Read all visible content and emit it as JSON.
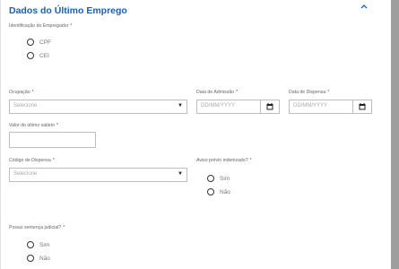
{
  "section": {
    "title": "Dados do Último Emprego"
  },
  "employer_id": {
    "label": "Identificação do Empregador",
    "required_mark": "*",
    "options": [
      "CPF",
      "CEI"
    ]
  },
  "occupation": {
    "label": "Ocupação",
    "required_mark": "*",
    "placeholder": "Selecione",
    "caret": "▼"
  },
  "admission_date": {
    "label": "Data de Admissão",
    "required_mark": "*",
    "placeholder": "DD/MM/YYYY"
  },
  "dismissal_date": {
    "label": "Data de Dispensa",
    "required_mark": "*",
    "placeholder": "DD/MM/YYYY"
  },
  "last_salary": {
    "label": "Valor do último salário",
    "required_mark": "*",
    "value": ""
  },
  "dismissal_code": {
    "label": "Código de Dispensa",
    "required_mark": "*",
    "placeholder": "Selecione",
    "caret": "▼"
  },
  "notice_indemnified": {
    "label": "Aviso prévio indenizado?",
    "required_mark": "*",
    "options": [
      "Sim",
      "Não"
    ]
  },
  "court_sentence": {
    "label": "Possui sentença judicial?",
    "required_mark": "*",
    "options": [
      "Sim",
      "Não"
    ]
  },
  "icons": {
    "collapse": "chevron-up-icon",
    "calendar": "calendar-icon"
  },
  "colors": {
    "title": "#1f5fa8",
    "required": "#d32f2f"
  }
}
